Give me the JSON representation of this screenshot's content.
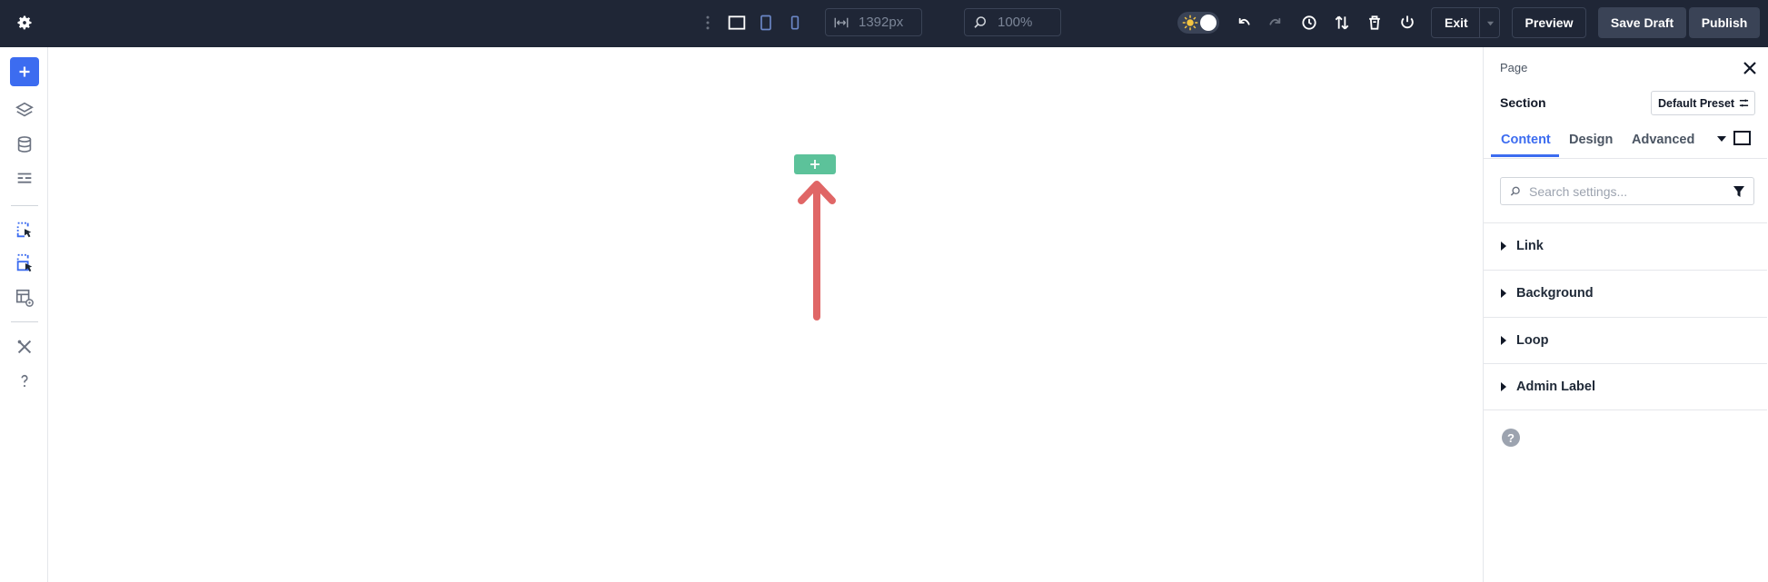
{
  "topbar": {
    "width_value": "1392px",
    "zoom_value": "100%",
    "exit_label": "Exit",
    "preview_label": "Preview",
    "save_draft_label": "Save Draft",
    "publish_label": "Publish"
  },
  "canvas": {
    "add_section_glyph": "+"
  },
  "panel": {
    "breadcrumb": "Page",
    "title": "Section",
    "preset_label": "Default Preset",
    "tabs": [
      "Content",
      "Design",
      "Advanced"
    ],
    "search_placeholder": "Search settings...",
    "accordions": [
      "Link",
      "Background",
      "Loop",
      "Admin Label"
    ],
    "help_glyph": "?"
  },
  "colors": {
    "topbar_bg": "#1f2636",
    "accent": "#3c6cf0",
    "add_section": "#5cc29a",
    "arrow": "#e06666"
  }
}
